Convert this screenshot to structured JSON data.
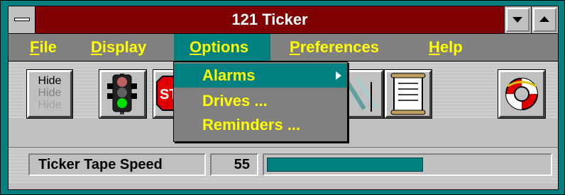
{
  "window": {
    "title": "121 Ticker",
    "minimize_icon": "triangle-down-icon",
    "maximize_icon": "triangle-up-icon",
    "system_menu_icon": "system-menu-bar-icon"
  },
  "menubar": {
    "items": [
      {
        "label": "File",
        "mnemonic": "F",
        "rest": "ile"
      },
      {
        "label": "Display",
        "mnemonic": "D",
        "rest": "isplay"
      },
      {
        "label": "Options",
        "mnemonic": "O",
        "rest": "ptions",
        "active": true
      },
      {
        "label": "Preferences",
        "mnemonic": "P",
        "rest": "references"
      },
      {
        "label": "Help",
        "mnemonic": "H",
        "rest": "elp"
      }
    ]
  },
  "options_menu": {
    "items": [
      {
        "label": "Alarms",
        "submenu": true,
        "highlighted": true
      },
      {
        "label": "Drives ..."
      },
      {
        "label": "Reminders ..."
      }
    ]
  },
  "toolbar": {
    "hide_button": {
      "lines": [
        "Hide",
        "Hide",
        "Hide"
      ]
    },
    "buttons": [
      "traffic-light-icon",
      "stop-sign-icon",
      "slide-icon",
      "scroll-document-icon",
      "life-preserver-icon"
    ],
    "stop_letter": "ST"
  },
  "status": {
    "label": "Ticker Tape Speed",
    "value": "55",
    "progress_fraction": 0.55
  },
  "colors": {
    "frame": "#008080",
    "titlebar": "#800000",
    "menubar": "#808080",
    "menu_text": "#ffff00",
    "highlight": "#008080",
    "progress_fill": "#008080"
  }
}
